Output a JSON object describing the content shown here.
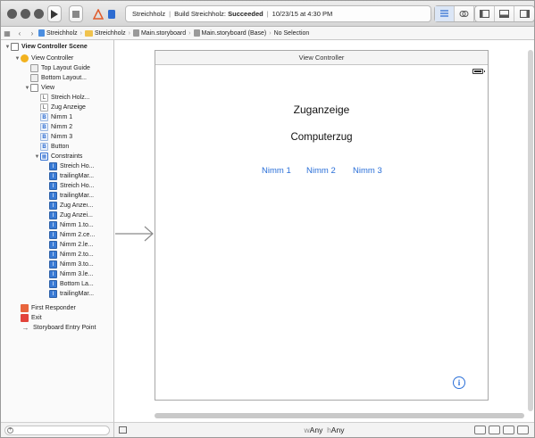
{
  "toolbar": {
    "scheme": "Streichholz",
    "status_project": "Streichholz",
    "status_build_prefix": "Build Streichholz:",
    "status_build_result": "Succeeded",
    "status_time": "10/23/15 at 4:30 PM"
  },
  "jumpbar": {
    "items": [
      "Streichholz",
      "Streichholz",
      "Main.storyboard",
      "Main.storyboard (Base)",
      "No Selection"
    ]
  },
  "outline": {
    "scene": "View Controller Scene",
    "view_controller": "View Controller",
    "top_layout_guide": "Top Layout Guide",
    "bottom_layout_guide": "Bottom Layout...",
    "view": "View",
    "label_streichholz": "Streich Holz...",
    "label_zug": "Zug Anzeige",
    "nimm1": "Nimm 1",
    "nimm2": "Nimm 2",
    "nimm3": "Nimm 3",
    "button": "Button",
    "constraints": "Constraints",
    "constraint_items": [
      "Streich Ho...",
      "trailingMar...",
      "Streich Ho...",
      "trailingMar...",
      "Zug Anzeı...",
      "Zug Anzei...",
      "Nimm 1.to...",
      "Nimm 2.ce...",
      "Nimm 2.le...",
      "Nimm 2.to...",
      "Nimm 3.to...",
      "Nimm 3.le...",
      "Bottom La...",
      "trailingMar..."
    ],
    "first_responder": "First Responder",
    "exit": "Exit",
    "entry_point": "Storyboard Entry Point"
  },
  "canvas": {
    "vc_title": "View Controller",
    "label1": "Zuganzeige",
    "label2": "Computerzug",
    "buttons": [
      "Nimm 1",
      "Nimm 2",
      "Nimm 3"
    ],
    "info_glyph": "i"
  },
  "bottombar": {
    "w_prefix": "w",
    "w_value": "Any",
    "h_prefix": "h",
    "h_value": "Any"
  }
}
